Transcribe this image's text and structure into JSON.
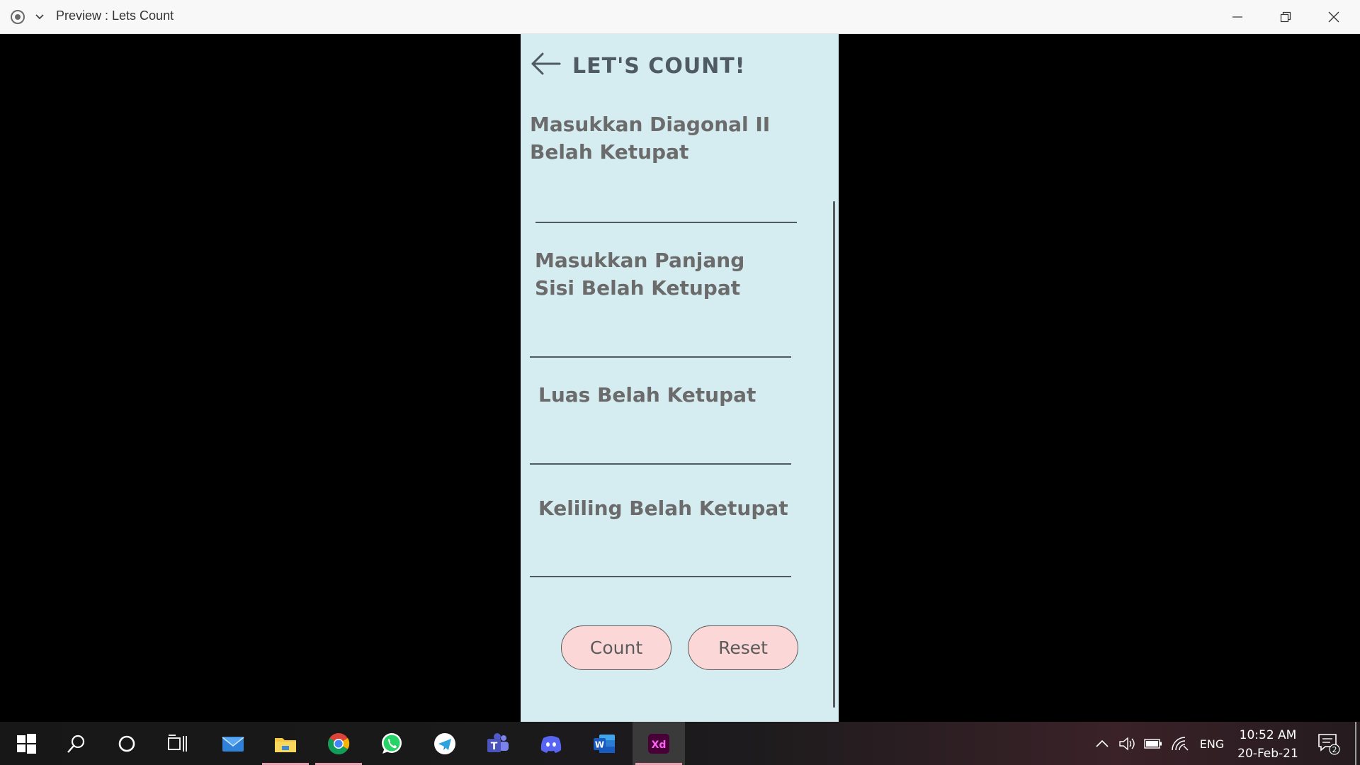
{
  "window": {
    "title": "Preview : Lets Count"
  },
  "app": {
    "title": "LET'S COUNT!",
    "fields": [
      {
        "label": "Masukkan Diagonal II Belah Ketupat",
        "value": ""
      },
      {
        "label": "Masukkan Panjang Sisi Belah Ketupat",
        "value": ""
      },
      {
        "label": "Luas Belah Ketupat",
        "value": ""
      },
      {
        "label": "Keliling Belah Ketupat",
        "value": ""
      }
    ],
    "buttons": {
      "count": "Count",
      "reset": "Reset"
    },
    "colors": {
      "background": "#d5ecf1",
      "button": "#fcd7d7",
      "text": "#6b6b6b"
    }
  },
  "taskbar": {
    "icons": [
      "windows-start-icon",
      "search-icon",
      "cortana-icon",
      "task-view-icon",
      "mail-icon",
      "file-explorer-icon",
      "chrome-icon",
      "whatsapp-icon",
      "telegram-icon",
      "teams-icon",
      "discord-icon",
      "word-icon",
      "adobe-xd-icon"
    ],
    "tray": {
      "language": "ENG",
      "time": "10:52 AM",
      "date": "20-Feb-21",
      "notifications": "2"
    },
    "teams_badge": "T",
    "word_badge": "W",
    "xd_badge": "Xd"
  }
}
